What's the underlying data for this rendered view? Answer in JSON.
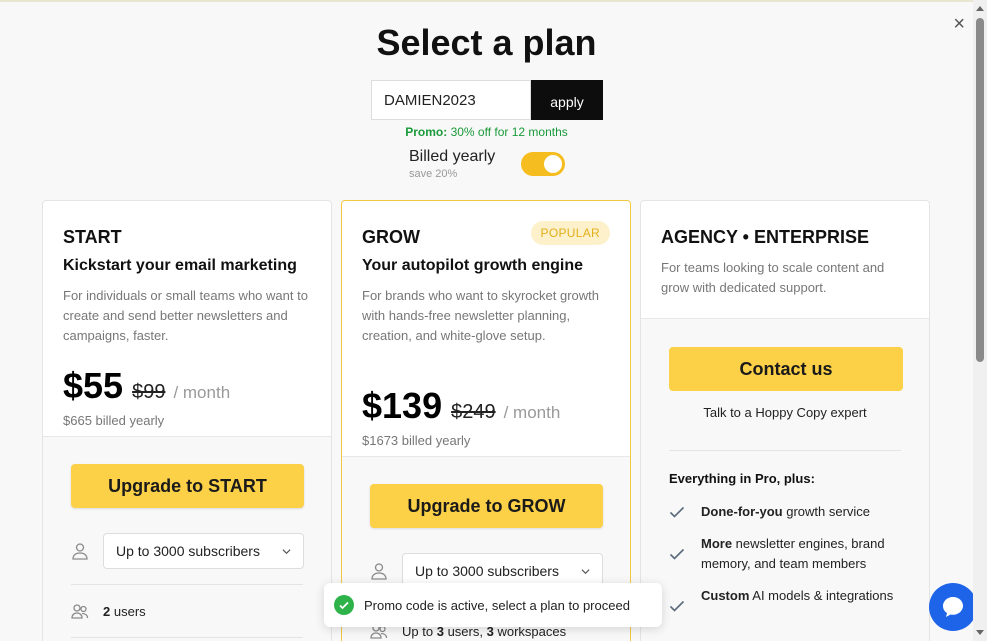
{
  "dialog": {
    "title": "Select a plan",
    "close_glyph": "×"
  },
  "promo": {
    "code_value": "DAMIEN2023",
    "apply_label": "apply",
    "note_label": "Promo:",
    "note_text": "30% off for 12 months"
  },
  "billing": {
    "label": "Billed yearly",
    "save": "save 20%",
    "enabled": true
  },
  "plans": [
    {
      "name": "START",
      "subtitle": "Kickstart your email marketing",
      "description": "For individuals or small teams who want to create and send better newsletters and campaigns, faster.",
      "price": "$55",
      "old_price": "$99",
      "per": "/ month",
      "billed": "$665 billed yearly",
      "cta": "Upgrade to START",
      "subscribers": "Up to 3000 subscribers",
      "users_count": "2",
      "users_label": "users"
    },
    {
      "name": "GROW",
      "badge": "POPULAR",
      "subtitle": "Your autopilot growth engine",
      "description": "For brands who want to skyrocket growth with hands-free newsletter planning, creation, and white-glove setup.",
      "price": "$139",
      "old_price": "$249",
      "per": "/ month",
      "billed": "$1673 billed yearly",
      "cta": "Upgrade to GROW",
      "subscribers": "Up to 3000 subscribers",
      "users_prefix": "Up to",
      "users_count": "3",
      "users_label": "users,",
      "workspaces_count": "3",
      "workspaces_label": "workspaces"
    },
    {
      "name": "AGENCY • ENTERPRISE",
      "description": "For teams looking to scale content and grow with dedicated support.",
      "cta": "Contact us",
      "cta_note": "Talk to a Hoppy Copy expert",
      "includes_heading": "Everything in Pro, plus:",
      "features": [
        {
          "bold": "Done-for-you",
          "rest": " growth service"
        },
        {
          "bold": "More",
          "rest": " newsletter engines, brand memory, and team members"
        },
        {
          "bold": "Custom",
          "rest": " AI models & integrations"
        }
      ]
    }
  ],
  "toast": {
    "message": "Promo code is active, select a plan to proceed"
  },
  "colors": {
    "accent": "#fcd047",
    "toggle": "#f5bd1f",
    "promo_green": "#1a9a3a",
    "toast_green": "#2db34a",
    "chat_blue": "#1d64e8"
  },
  "icons": {
    "close": "close-icon",
    "user": "user-icon",
    "users": "users-icon",
    "chevron": "chevron-down-icon",
    "check": "check-icon",
    "success": "check-circle-icon",
    "chat": "chat-bubble-icon"
  }
}
